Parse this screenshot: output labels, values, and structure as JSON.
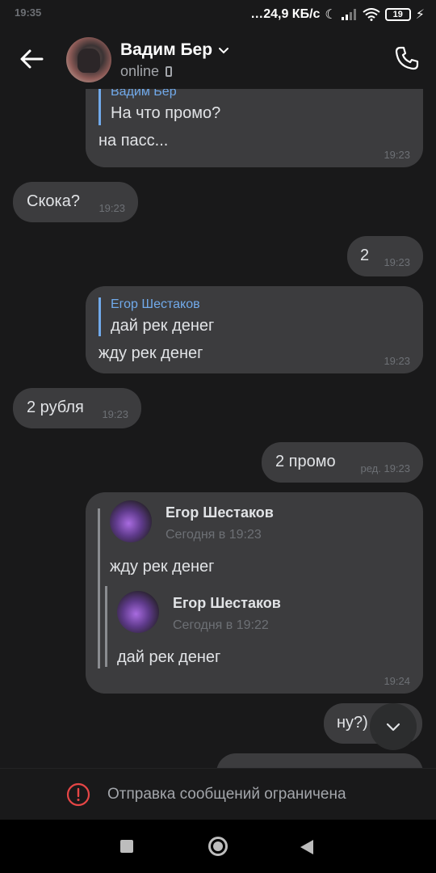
{
  "status_bar": {
    "time": "19:35",
    "network_speed": "24,9 КБ/с",
    "battery": "19"
  },
  "header": {
    "name": "Вадим Бер",
    "status": "online"
  },
  "messages": [
    {
      "id": "m1",
      "direction": "out",
      "reply_name": "Вадим Бер",
      "reply_text": "На что промо?",
      "text": "на пасс...",
      "time": "19:23"
    },
    {
      "id": "m2",
      "direction": "in",
      "text": "Скока?",
      "time": "19:23"
    },
    {
      "id": "m3",
      "direction": "out",
      "text": "2",
      "time": "19:23"
    },
    {
      "id": "m4",
      "direction": "out",
      "reply_name": "Егор Шестаков",
      "reply_text": "дай рек денег",
      "text": "жду рек денег",
      "time": "19:23"
    },
    {
      "id": "m5",
      "direction": "in",
      "text": "2 рубля",
      "time": "19:23"
    },
    {
      "id": "m6",
      "direction": "out",
      "text": "2 промо",
      "time": "ред. 19:23"
    },
    {
      "id": "m7",
      "direction": "out",
      "forwarded": [
        {
          "name": "Егор Шестаков",
          "date": "Сегодня в 19:23",
          "text": "жду рек денег"
        },
        {
          "name": "Егор Шестаков",
          "date": "Сегодня в 19:22",
          "text": "дай рек денег"
        }
      ],
      "time": "19:24"
    },
    {
      "id": "m8",
      "direction": "out",
      "text": "ну?)"
    }
  ],
  "composer": {
    "restricted_text": "Отправка сообщений ограничена"
  },
  "colors": {
    "background": "#19191a",
    "bubble": "#3c3c3e",
    "accent": "#71aaeb",
    "warning": "#e64646"
  }
}
